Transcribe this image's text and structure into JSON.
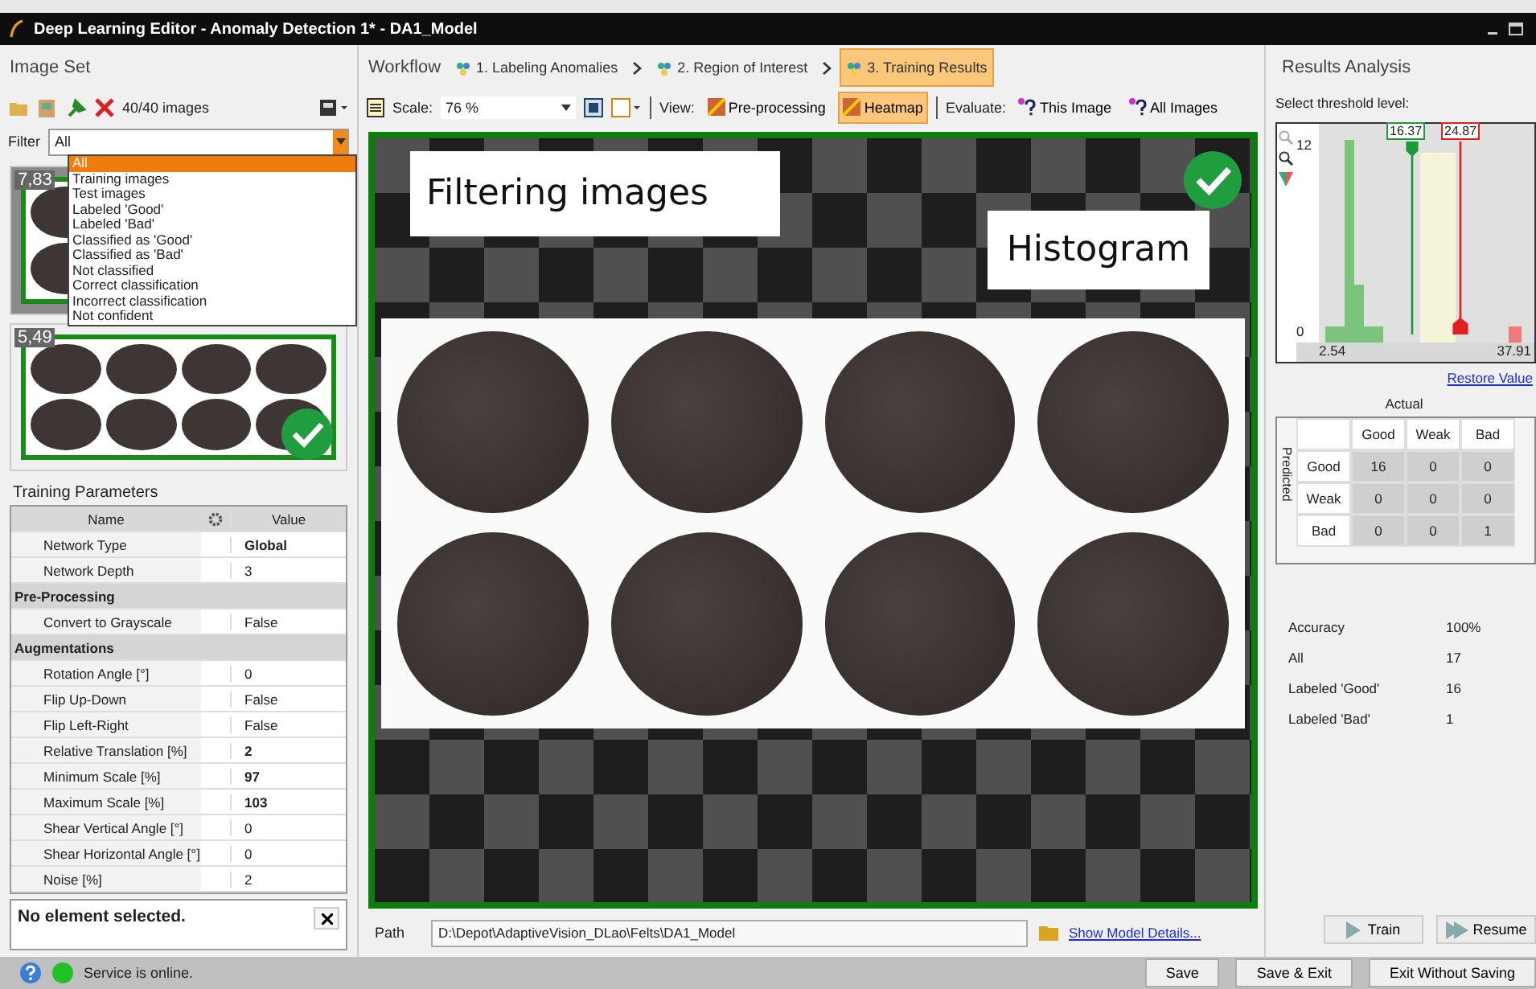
{
  "window": {
    "title": "Deep Learning Editor - Anomaly Detection 1* - DA1_Model"
  },
  "image_set": {
    "title": "Image Set",
    "count": "40/40 images",
    "filter_label": "Filter",
    "filter_value": "All",
    "filter_options": [
      {
        "label": "All",
        "selected": true
      },
      {
        "label": "Training images",
        "selected": false
      },
      {
        "label": "Test images",
        "selected": false
      },
      {
        "label": "Labeled 'Good'",
        "selected": false
      },
      {
        "label": "Labeled 'Bad'",
        "selected": false
      },
      {
        "label": "Classified as 'Good'",
        "selected": false
      },
      {
        "label": "Classified as 'Bad'",
        "selected": false
      },
      {
        "label": "Not classified",
        "selected": false
      },
      {
        "label": "Correct classification",
        "selected": false
      },
      {
        "label": "Incorrect classification",
        "selected": false
      },
      {
        "label": "Not confident",
        "selected": false
      }
    ],
    "thumbnails": [
      {
        "score": "7,83",
        "selected": true
      },
      {
        "score": "5,49",
        "selected": false,
        "checked": true
      }
    ]
  },
  "training_parameters": {
    "title": "Training Parameters",
    "columns": [
      "Name",
      "Value"
    ],
    "rows": [
      {
        "kind": "param",
        "name": "Network Type",
        "value": "Global",
        "bold": true
      },
      {
        "kind": "param",
        "name": "Network Depth",
        "value": "3",
        "bold": false
      },
      {
        "kind": "group",
        "name": "Pre-Processing"
      },
      {
        "kind": "param",
        "name": "Convert to Grayscale",
        "value": "False",
        "bold": false
      },
      {
        "kind": "group",
        "name": "Augmentations"
      },
      {
        "kind": "param",
        "name": "Rotation Angle [°]",
        "value": "0",
        "bold": false
      },
      {
        "kind": "param",
        "name": "Flip Up-Down",
        "value": "False",
        "bold": false
      },
      {
        "kind": "param",
        "name": "Flip Left-Right",
        "value": "False",
        "bold": false
      },
      {
        "kind": "param",
        "name": "Relative Translation [%]",
        "value": "2",
        "bold": true
      },
      {
        "kind": "param",
        "name": "Minimum Scale [%]",
        "value": "97",
        "bold": true
      },
      {
        "kind": "param",
        "name": "Maximum Scale [%]",
        "value": "103",
        "bold": true
      },
      {
        "kind": "param",
        "name": "Shear Vertical Angle [°]",
        "value": "0",
        "bold": false
      },
      {
        "kind": "param",
        "name": "Shear Horizontal Angle [°]",
        "value": "0",
        "bold": false
      },
      {
        "kind": "param",
        "name": "Noise [%]",
        "value": "2",
        "bold": false
      }
    ],
    "info": "No element selected."
  },
  "workflow": {
    "title": "Workflow",
    "steps": [
      {
        "label": "1. Labeling Anomalies",
        "selected": false
      },
      {
        "label": "2. Region of Interest",
        "selected": false
      },
      {
        "label": "3. Training Results",
        "selected": true
      }
    ]
  },
  "toolbar": {
    "scale_label": "Scale:",
    "scale_value": "76 %",
    "view_label": "View:",
    "views": [
      {
        "label": "Pre-processing",
        "selected": false
      },
      {
        "label": "Heatmap",
        "selected": true
      }
    ],
    "evaluate_label": "Evaluate:",
    "evaluate": [
      "This Image",
      "All Images"
    ]
  },
  "viewer": {
    "checked": true,
    "callouts": [
      "Filtering images",
      "Histogram"
    ]
  },
  "path": {
    "label": "Path",
    "value": "D:\\Depot\\AdaptiveVision_DLao\\Felts\\DA1_Model",
    "link": "Show Model Details..."
  },
  "results": {
    "title": "Results Analysis",
    "threshold_label": "Select threshold level:",
    "histogram": {
      "y_max": "12",
      "y_min": "0",
      "x_min": "2.54",
      "x_max": "37.91",
      "good_threshold": "16.37",
      "bad_threshold": "24.87"
    },
    "restore": "Restore Value",
    "matrix": {
      "actual": "Actual",
      "predicted": "Predicted",
      "columns": [
        "Good",
        "Weak",
        "Bad"
      ],
      "rows": [
        {
          "label": "Good",
          "values": [
            "16",
            "0",
            "0"
          ]
        },
        {
          "label": "Weak",
          "values": [
            "0",
            "0",
            "0"
          ]
        },
        {
          "label": "Bad",
          "values": [
            "0",
            "0",
            "1"
          ]
        }
      ]
    },
    "stats": [
      {
        "label": "Accuracy",
        "value": "100%"
      },
      {
        "label": "All",
        "value": "17"
      },
      {
        "label": "Labeled 'Good'",
        "value": "16"
      },
      {
        "label": "Labeled 'Bad'",
        "value": "1"
      }
    ],
    "buttons": [
      "Train",
      "Resume"
    ]
  },
  "status_bar": {
    "text": "Service is online.",
    "online": true,
    "buttons": [
      "Save",
      "Save & Exit",
      "Exit Without Saving"
    ]
  }
}
